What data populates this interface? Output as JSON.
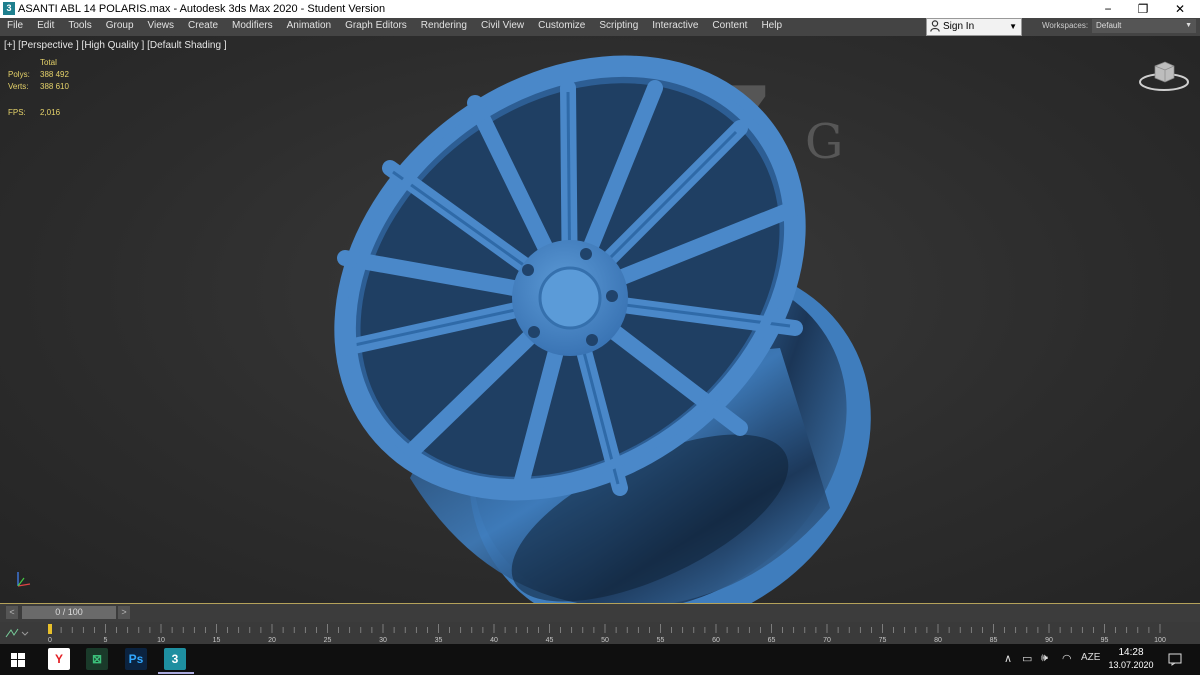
{
  "window": {
    "title": "ASANTI ABL 14 POLARIS.max - Autodesk 3ds Max 2020 - Student Version",
    "app_icon_label": "3",
    "minimize": "−",
    "maximize": "❐",
    "close": "✕"
  },
  "menu": [
    "File",
    "Edit",
    "Tools",
    "Group",
    "Views",
    "Create",
    "Modifiers",
    "Animation",
    "Graph Editors",
    "Rendering",
    "Civil View",
    "Customize",
    "Scripting",
    "Interactive",
    "Content",
    "Help"
  ],
  "signin": {
    "label": "Sign In",
    "icon": "person-icon",
    "arrow": "▼"
  },
  "workspaces": {
    "label": "Workspaces:",
    "value": "Default",
    "arrow": "▼"
  },
  "viewport": {
    "label": "[+] [Perspective ] [High Quality ] [Default Shading ]",
    "stats": {
      "header": "Total",
      "polys_label": "Polys:",
      "polys_value": "388 492",
      "verts_label": "Verts:",
      "verts_value": "388 610",
      "fps_label": "FPS:",
      "fps_value": "2,016"
    },
    "watermark": {
      "big": "Z",
      "small": "G"
    },
    "model_color": "#4a88c9"
  },
  "timeline": {
    "prev": "<",
    "frame_label": "0 / 100",
    "next": ">",
    "current_frame": 0,
    "total_frames": 100,
    "ticks": [
      "0",
      "5",
      "10",
      "15",
      "20",
      "25",
      "30",
      "35",
      "40",
      "45",
      "50",
      "55",
      "60",
      "65",
      "70",
      "75",
      "80",
      "85",
      "90",
      "95",
      "100"
    ]
  },
  "taskbar": {
    "apps": [
      {
        "name": "yandex-browser-icon",
        "label": "Y",
        "color": "#e31e24",
        "bg": "#ffffff"
      },
      {
        "name": "cad-app-icon",
        "label": "⊠",
        "color": "#3bbf7a",
        "bg": "#1a3a2a"
      },
      {
        "name": "photoshop-icon",
        "label": "Ps",
        "color": "#31a8ff",
        "bg": "#0b2340"
      },
      {
        "name": "3dsmax-icon",
        "label": "3",
        "color": "#ffffff",
        "bg": "#1e8fa0"
      }
    ],
    "tray": {
      "chevron": "∧",
      "battery": "▭",
      "volume": "🕪",
      "network": "◠",
      "language": "AZE"
    },
    "time": "14:28",
    "date": "13.07.2020"
  }
}
